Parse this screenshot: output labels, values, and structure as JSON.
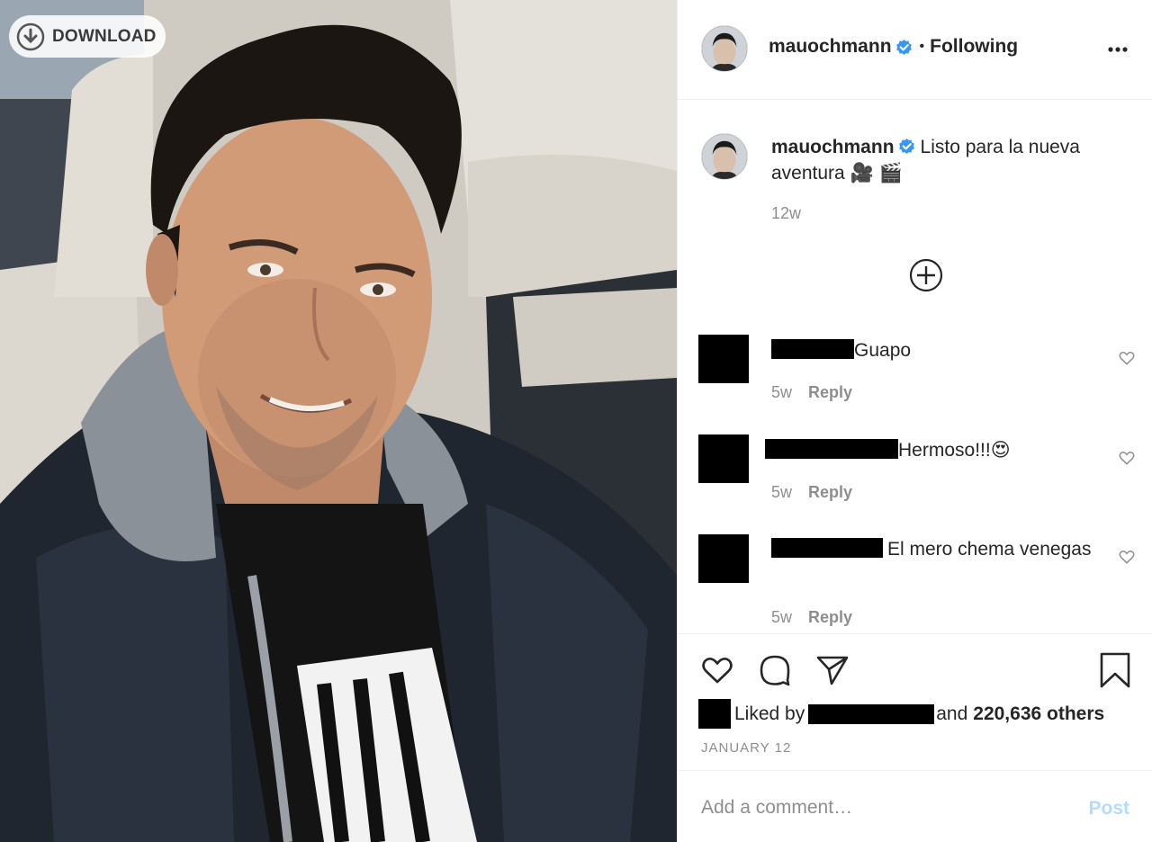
{
  "download": {
    "label": "DOWNLOAD"
  },
  "header": {
    "username": "mauochmann",
    "separator": "•",
    "follow_status": "Following"
  },
  "caption": {
    "username": "mauochmann",
    "text": "Listo para la nueva aventura 🎥 🎬",
    "time": "12w"
  },
  "comments": [
    {
      "text": "Guapo",
      "time": "5w",
      "reply": "Reply"
    },
    {
      "text": "Hermoso!!!😍",
      "time": "5w",
      "reply": "Reply"
    },
    {
      "text": "El mero chema venegas",
      "time": "5w",
      "reply": "Reply"
    }
  ],
  "likes": {
    "prefix": "Liked by",
    "connector": "and",
    "others": "220,636 others"
  },
  "post_date": "JANUARY 12",
  "comment_box": {
    "placeholder": "Add a comment…",
    "post_label": "Post"
  },
  "colors": {
    "accent": "#0095f6",
    "post_disabled": "#b3dbff",
    "muted_text": "#8e8e8e",
    "verified": "#3897f0"
  },
  "icons": [
    "download-icon",
    "verified-icon",
    "more-options-icon",
    "load-more-comments-icon",
    "heart-icon",
    "comment-icon",
    "share-icon",
    "bookmark-icon"
  ]
}
